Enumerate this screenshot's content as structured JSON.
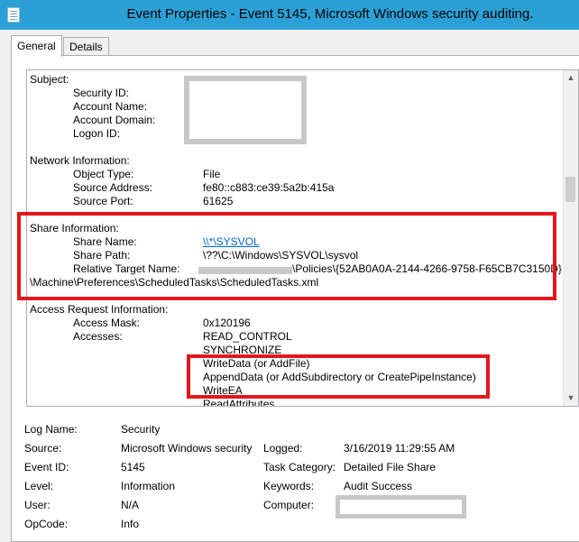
{
  "window": {
    "title": "Event Properties - Event 5145, Microsoft Windows security auditing.",
    "icon": "event-log-icon"
  },
  "tabs": [
    {
      "label": "General",
      "active": true
    },
    {
      "label": "Details",
      "active": false
    }
  ],
  "description": {
    "subject_header": "Subject:",
    "subject": {
      "security_id": "Security ID:",
      "account_name": "Account Name:",
      "account_domain": "Account Domain:",
      "logon_id": "Logon ID:"
    },
    "network_header": "Network Information:",
    "network": {
      "object_type_label": "Object Type:",
      "object_type_value": "File",
      "source_address_label": "Source Address:",
      "source_address_value": "fe80::c883:ce39:5a2b:415a",
      "source_port_label": "Source Port:",
      "source_port_value": "61625"
    },
    "share_header": "Share Information:",
    "share": {
      "share_name_label": "Share Name:",
      "share_name_value": "\\\\*\\SYSVOL",
      "share_path_label": "Share Path:",
      "share_path_value": "\\??\\C:\\Windows\\SYSVOL\\sysvol",
      "relative_target_label": "Relative Target Name:",
      "relative_target_value": "\\Policies\\{52AB0A0A-2144-4266-9758-F65CB7C3150D}",
      "relative_target_cont": "\\Machine\\Preferences\\ScheduledTasks\\ScheduledTasks.xml"
    },
    "access_header": "Access Request Information:",
    "access": {
      "access_mask_label": "Access Mask:",
      "access_mask_value": "0x120196",
      "accesses_label": "Accesses:",
      "accesses": [
        "READ_CONTROL",
        "SYNCHRONIZE",
        "WriteData (or AddFile)",
        "AppendData (or AddSubdirectory or CreatePipeInstance)",
        "WriteEA",
        "ReadAttributes"
      ]
    }
  },
  "fields": {
    "log_name_label": "Log Name:",
    "log_name_value": "Security",
    "source_label": "Source:",
    "source_value": "Microsoft Windows security",
    "logged_label": "Logged:",
    "logged_value": "3/16/2019 11:29:55 AM",
    "event_id_label": "Event ID:",
    "event_id_value": "5145",
    "task_category_label": "Task Category:",
    "task_category_value": "Detailed File Share",
    "level_label": "Level:",
    "level_value": "Information",
    "keywords_label": "Keywords:",
    "keywords_value": "Audit Success",
    "user_label": "User:",
    "user_value": "N/A",
    "computer_label": "Computer:",
    "opcode_label": "OpCode:",
    "opcode_value": "Info"
  },
  "colors": {
    "titlebar": "#2aa0d6",
    "highlight_box": "#e2171b",
    "link": "#0066cc",
    "redaction": "#c8c8c8"
  }
}
